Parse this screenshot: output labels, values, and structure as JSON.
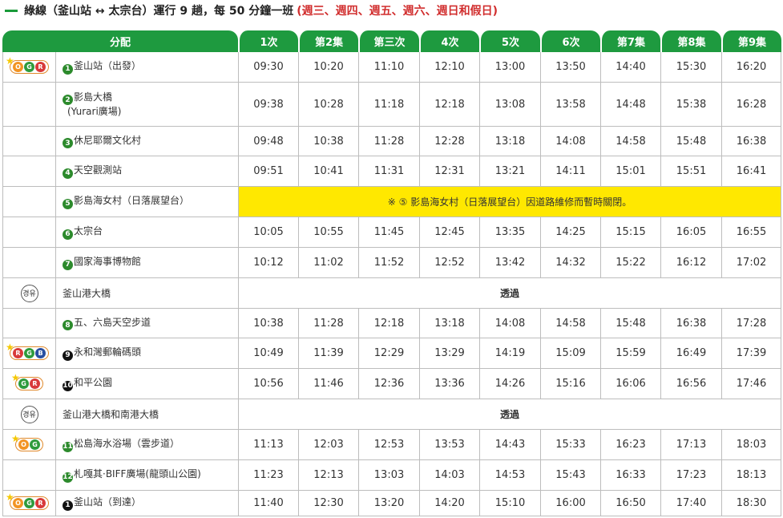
{
  "title": {
    "line": "綠線（釜山站 ↔ 太宗台）運行 9 趟，每 50 分鐘一班",
    "days": "(週三、週四、週五、週六、週日和假日)"
  },
  "table": {
    "headers": [
      "分配",
      "1次",
      "第2集",
      "第三次",
      "4次",
      "5次",
      "6次",
      "第7集",
      "第8集",
      "第9集"
    ],
    "rows": [
      {
        "icon": "OGR",
        "star": "★",
        "num": "1",
        "numstyle": "green",
        "stop": "釜山站（出發）",
        "times": [
          "09:30",
          "10:20",
          "11:10",
          "12:10",
          "13:00",
          "13:50",
          "14:40",
          "15:30",
          "16:20"
        ]
      },
      {
        "icon": "",
        "num": "2",
        "numstyle": "green",
        "stop": "影島大橋",
        "stop2": "(Yurari廣場)",
        "times": [
          "09:38",
          "10:28",
          "11:18",
          "12:18",
          "13:08",
          "13:58",
          "14:48",
          "15:38",
          "16:28"
        ]
      },
      {
        "icon": "",
        "num": "3",
        "numstyle": "green",
        "stop": "休尼耶爾文化村",
        "times": [
          "09:48",
          "10:38",
          "11:28",
          "12:28",
          "13:18",
          "14:08",
          "14:58",
          "15:48",
          "16:38"
        ]
      },
      {
        "icon": "",
        "num": "4",
        "numstyle": "green",
        "stop": "天空觀測站",
        "times": [
          "09:51",
          "10:41",
          "11:31",
          "12:31",
          "13:21",
          "14:11",
          "15:01",
          "15:51",
          "16:41"
        ]
      },
      {
        "icon": "",
        "num": "5",
        "numstyle": "green",
        "stop": "影島海女村（日落展望台）",
        "notice": "※ ⑤ 影島海女村（日落展望台）因道路維修而暫時關閉。"
      },
      {
        "icon": "",
        "num": "6",
        "numstyle": "green",
        "stop": "太宗台",
        "times": [
          "10:05",
          "10:55",
          "11:45",
          "12:45",
          "13:35",
          "14:25",
          "15:15",
          "16:05",
          "16:55"
        ]
      },
      {
        "icon": "",
        "num": "7",
        "numstyle": "green",
        "stop": "國家海事博物館",
        "times": [
          "10:12",
          "11:02",
          "11:52",
          "12:52",
          "13:42",
          "14:32",
          "15:22",
          "16:12",
          "17:02"
        ]
      },
      {
        "icon": "VIA",
        "via": "경유",
        "num": "",
        "stop": "釜山港大橋",
        "pass": "透過"
      },
      {
        "icon": "",
        "num": "8",
        "numstyle": "green",
        "stop": "五、六島天空步道",
        "times": [
          "10:38",
          "11:28",
          "12:18",
          "13:18",
          "14:08",
          "14:58",
          "15:48",
          "16:38",
          "17:28"
        ]
      },
      {
        "icon": "RGB",
        "star": "★",
        "num": "9",
        "numstyle": "black",
        "stop": "永和灣郵輪碼頭",
        "times": [
          "10:49",
          "11:39",
          "12:29",
          "13:29",
          "14:19",
          "15:09",
          "15:59",
          "16:49",
          "17:39"
        ]
      },
      {
        "icon": "GR",
        "star": "★",
        "num": "10",
        "numstyle": "black",
        "stop": "和平公園",
        "times": [
          "10:56",
          "11:46",
          "12:36",
          "13:36",
          "14:26",
          "15:16",
          "16:06",
          "16:56",
          "17:46"
        ]
      },
      {
        "icon": "VIA",
        "via": "경유",
        "num": "",
        "stop": "釜山港大橋和南港大橋",
        "pass": "透過"
      },
      {
        "icon": "OG",
        "star": "★",
        "num": "11",
        "numstyle": "green",
        "stop": "松島海水浴場（雲步道）",
        "times": [
          "11:13",
          "12:03",
          "12:53",
          "13:53",
          "14:43",
          "15:33",
          "16:23",
          "17:13",
          "18:03"
        ]
      },
      {
        "icon": "",
        "num": "12",
        "numstyle": "green",
        "stop": "札嘎其·BIFF廣場(龍頭山公園)",
        "times": [
          "11:23",
          "12:13",
          "13:03",
          "14:03",
          "14:53",
          "15:43",
          "16:33",
          "17:23",
          "18:13"
        ]
      },
      {
        "icon": "OGR",
        "star": "★",
        "num": "1",
        "numstyle": "black",
        "stop": "釜山站（到達）",
        "times": [
          "11:40",
          "12:30",
          "13:20",
          "14:20",
          "15:10",
          "16:00",
          "16:50",
          "17:40",
          "18:30"
        ]
      }
    ]
  }
}
